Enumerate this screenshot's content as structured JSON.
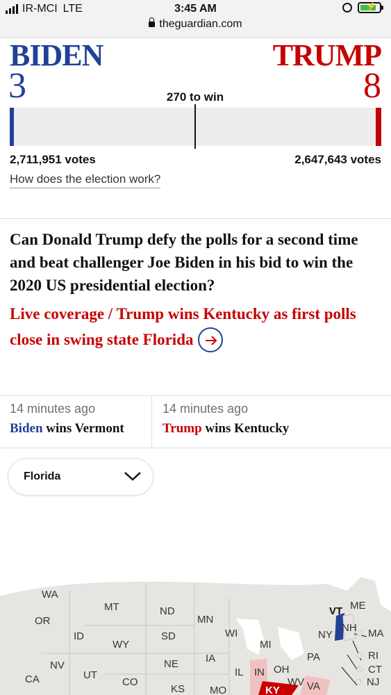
{
  "status_bar": {
    "carrier": "IR-MCI",
    "network": "LTE",
    "time": "3:45 AM",
    "url": "theguardian.com"
  },
  "results": {
    "biden": {
      "name": "BIDEN",
      "electoral_votes": "3",
      "popular_votes": "2,711,951 votes",
      "color": "#204197",
      "share": 0.011
    },
    "trump": {
      "name": "TRUMP",
      "electoral_votes": "8",
      "popular_votes": "2,647,643 votes",
      "color": "#c70000",
      "share": 0.015
    },
    "win_label": "270 to win",
    "how_link": "How does the election work?"
  },
  "article": {
    "headline": "Can Donald Trump defy the polls for a second time and beat challenger Joe Biden in his bid to win the 2020 US presidential election?",
    "live_link": "Live coverage / Trump wins Kentucky as first polls close in swing state Florida"
  },
  "updates": [
    {
      "time": "14 minutes ago",
      "candidate": "Biden",
      "text": " wins Vermont",
      "color": "#204197"
    },
    {
      "time": "14 minutes ago",
      "candidate": "Trump",
      "text": " wins Kentucky",
      "color": "#c70000"
    }
  ],
  "state_select": {
    "selected": "Florida"
  },
  "map": {
    "states": [
      "WA",
      "MT",
      "ND",
      "MN",
      "VT",
      "ME",
      "OR",
      "ID",
      "SD",
      "WI",
      "NH",
      "NY",
      "MA",
      "WY",
      "MI",
      "RI",
      "IA",
      "PA",
      "CT",
      "NV",
      "NE",
      "IL",
      "IN",
      "OH",
      "NJ",
      "CA",
      "UT",
      "CO",
      "KS",
      "MO",
      "WV",
      "VA",
      "KY"
    ],
    "colors": {
      "land": "#e6e5e1",
      "biden_won": "#204197",
      "trump_won": "#c70000",
      "trump_leaning": "#f1c1c1",
      "water": "#ffffff"
    }
  }
}
